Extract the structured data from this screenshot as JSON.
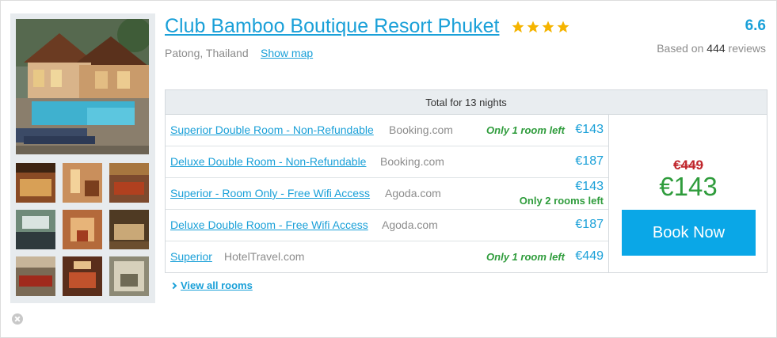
{
  "hotel": {
    "name": "Club Bamboo Boutique Resort Phuket",
    "star_count": 4,
    "star_color": "#f5b400",
    "location": "Patong, Thailand",
    "show_map_label": "Show map"
  },
  "rating": {
    "score": "6.6",
    "based_on_label": "Based on",
    "review_count": "444",
    "reviews_label": "reviews"
  },
  "gallery": {
    "main_photo": "resort-pool-photo",
    "thumbnails": [
      "room-photo",
      "terrace-photo",
      "bedroom-photo",
      "pool-photo",
      "suite-photo",
      "lounge-photo",
      "dining-photo",
      "living-room-photo",
      "bath-photo"
    ]
  },
  "rooms": {
    "header": "Total for 13 nights",
    "rows": [
      {
        "name": "Superior Double Room - Non-Refundable",
        "provider": "Booking.com",
        "availability": "Only 1 room left",
        "price": "€143"
      },
      {
        "name": "Deluxe Double Room - Non-Refundable",
        "provider": "Booking.com",
        "availability": "",
        "price": "€187"
      },
      {
        "name": "Superior - Room Only - Free Wifi Access",
        "provider": "Agoda.com",
        "availability": "Only 2 rooms left",
        "price": "€143"
      },
      {
        "name": "Deluxe Double Room - Free Wifi Access",
        "provider": "Agoda.com",
        "availability": "",
        "price": "€187"
      },
      {
        "name": "Superior",
        "provider": "HotelTravel.com",
        "availability": "Only 1 room left",
        "price": "€449"
      }
    ]
  },
  "deal": {
    "old_price": "€449",
    "price": "€143",
    "book_label": "Book Now"
  },
  "view_all_label": "View all rooms",
  "colors": {
    "link": "#1aa0d8",
    "availability": "#2f9c3c",
    "old_price": "#c0262c",
    "book_button": "#0aa7e7"
  }
}
